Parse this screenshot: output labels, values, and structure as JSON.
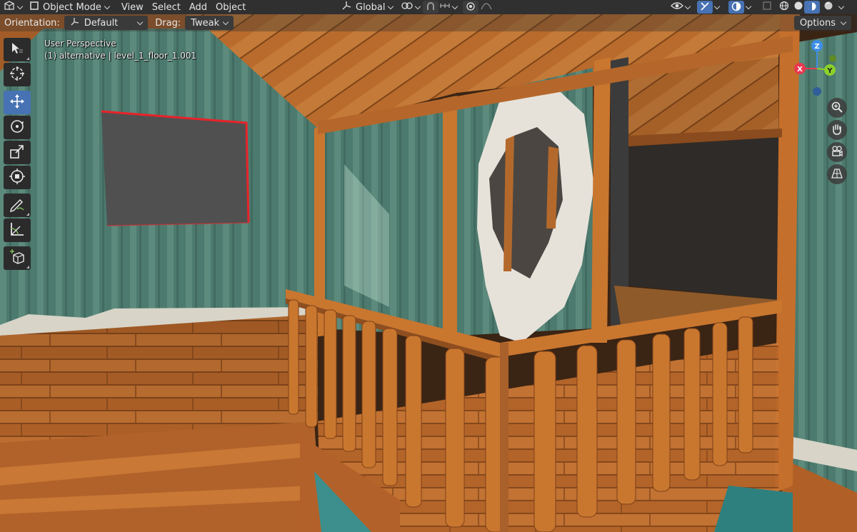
{
  "header": {
    "mode_label": "Object Mode",
    "menus": [
      "View",
      "Select",
      "Add",
      "Object"
    ],
    "transform_orientation": "Global"
  },
  "tool_settings": {
    "orientation_label": "Orientation:",
    "orientation_value": "Default",
    "drag_label": "Drag:",
    "drag_value": "Tweak",
    "options_label": "Options"
  },
  "viewport": {
    "perspective_label": "User Perspective",
    "object_info": "(1) alternative | level_1_floor_1.001"
  },
  "gizmo": {
    "x_label": "X",
    "y_label": "Y",
    "z_label": "Z",
    "x_color": "#e8384f",
    "y_color": "#8cd12a",
    "z_color": "#3d8fe6"
  },
  "tools": [
    {
      "name": "select-box-tool",
      "icon": "cursor-box-icon"
    },
    {
      "name": "cursor-tool",
      "icon": "crosshair-cursor-icon"
    },
    {
      "name": "move-tool",
      "icon": "move-arrows-icon",
      "active": true
    },
    {
      "name": "rotate-tool",
      "icon": "rotate-icon"
    },
    {
      "name": "scale-tool",
      "icon": "scale-icon"
    },
    {
      "name": "transform-tool",
      "icon": "transform-icon"
    },
    {
      "name": "annotate-tool",
      "icon": "pencil-annotate-icon"
    },
    {
      "name": "measure-tool",
      "icon": "ruler-measure-icon"
    },
    {
      "name": "add-cube-tool",
      "icon": "add-cube-icon"
    }
  ],
  "nav_buttons": [
    "zoom-icon",
    "hand-pan-icon",
    "camera-icon",
    "perspective-grid-icon"
  ],
  "colors": {
    "active_blue": "#4772b3",
    "header_bg": "#303030",
    "selection_outline": "#e8232a"
  }
}
